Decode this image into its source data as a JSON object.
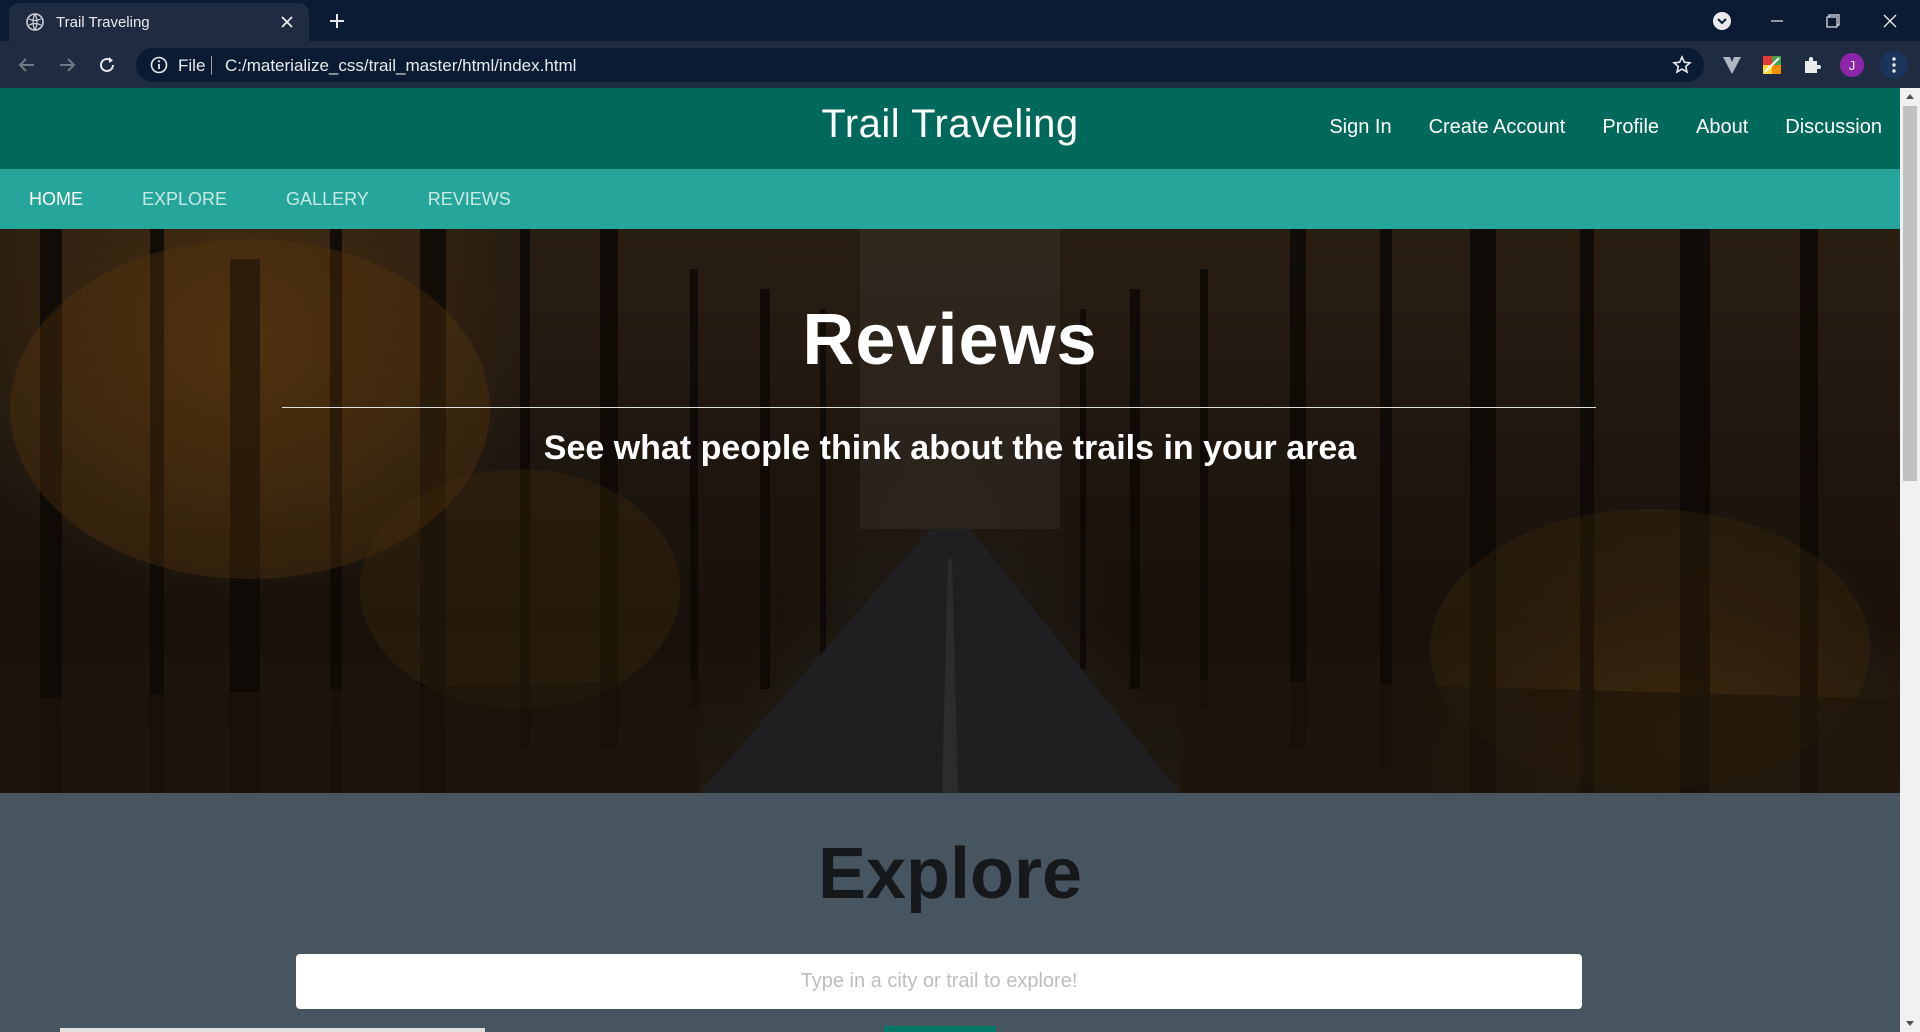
{
  "browser": {
    "tab_title": "Trail Traveling",
    "address_scheme": "File",
    "address_url": "C:/materialize_css/trail_master/html/index.html",
    "profile_initial": "J"
  },
  "site": {
    "brand": "Trail Traveling",
    "nav_links": [
      "Sign In",
      "Create Account",
      "Profile",
      "About",
      "Discussion"
    ],
    "tabs": [
      {
        "label": "HOME",
        "active": true
      },
      {
        "label": "EXPLORE",
        "active": false
      },
      {
        "label": "GALLERY",
        "active": false
      },
      {
        "label": "REVIEWS",
        "active": false
      }
    ],
    "hero": {
      "title": "Reviews",
      "subtitle": "See what people think about the trails in your area"
    },
    "explore": {
      "title": "Explore",
      "placeholder": "Type in a city or trail to explore!"
    }
  },
  "colors": {
    "navbar": "#00695c",
    "tabs_bar": "#26a69a",
    "explore_bg": "#46555f",
    "chrome_dark": "#0b1b33",
    "chrome_toolbar": "#1e2b40"
  }
}
